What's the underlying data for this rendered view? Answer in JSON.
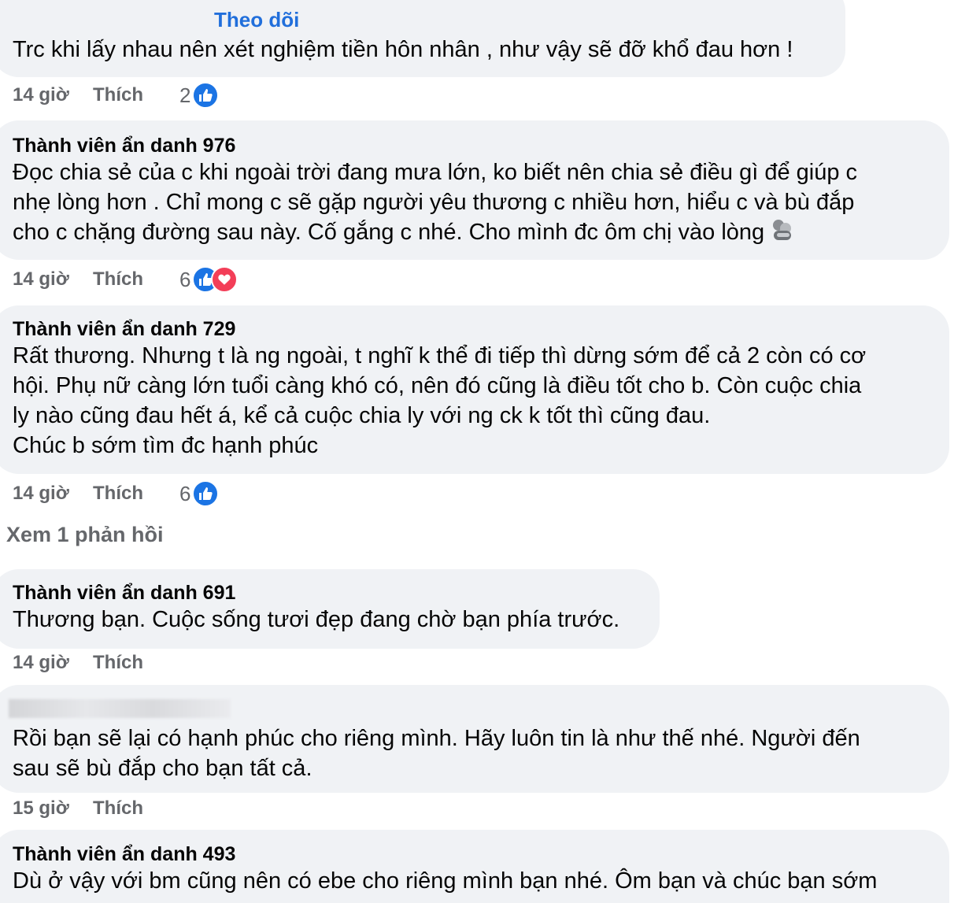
{
  "comments": [
    {
      "follow_label": "Theo dõi",
      "text": "Trc khi lấy nhau nên xét nghiệm tiền hôn nhân , như vậy sẽ đỡ khổ đau hơn !",
      "time": "14 giờ",
      "like_label": "Thích",
      "reaction_count": "2"
    },
    {
      "author": "Thành viên ẩn danh 976",
      "text": "Đọc chia sẻ của c khi ngoài trời đang mưa lớn, ko biết nên chia sẻ điều gì để giúp c\nnhẹ lòng hơn . Chỉ mong c sẽ gặp người yêu thương c nhiều hơn, hiểu c và bù đắp\ncho c chặng đường sau này. Cố gắng c nhé. Cho mình đc ôm chị vào lòng",
      "time": "14 giờ",
      "like_label": "Thích",
      "reaction_count": "6"
    },
    {
      "author": "Thành viên ẩn danh 729",
      "text": "Rất thương. Nhưng t là ng ngoài, t nghĩ k thể đi tiếp thì dừng sớm để cả 2 còn có cơ\nhội. Phụ nữ càng lớn tuổi càng khó có, nên đó cũng là điều tốt cho b. Còn cuộc chia\nly nào cũng đau hết á, kể cả cuộc chia ly với ng ck k tốt thì cũng đau.\nChúc b sớm tìm đc hạnh phúc",
      "time": "14 giờ",
      "like_label": "Thích",
      "reaction_count": "6"
    },
    {
      "author": "Thành viên ẩn danh 691",
      "text": "Thương bạn. Cuộc sống tươi đẹp đang chờ bạn phía trước.",
      "time": "14 giờ",
      "like_label": "Thích"
    },
    {
      "text": "Rồi bạn sẽ lại có hạnh phúc cho riêng mình. Hãy luôn tin là như thế nhé. Người đến\nsau sẽ bù đắp cho bạn tất cả.",
      "time": "15 giờ",
      "like_label": "Thích"
    },
    {
      "author": "Thành viên ẩn danh 493",
      "text": "Dù ở vậy với bm cũng nên có ebe cho riêng mình bạn nhé. Ôm bạn và chúc bạn sớm"
    }
  ],
  "view_replies_label": "Xem 1 phản hồi",
  "colors": {
    "bubble": "#f0f2f5",
    "link_blue": "#216fdb",
    "meta_gray": "#65676b",
    "like_blue": "#1b74e4",
    "love_red": "#f33e58"
  },
  "icons": [
    "thumbs-up-icon",
    "heart-icon",
    "hug-emoji-icon"
  ]
}
